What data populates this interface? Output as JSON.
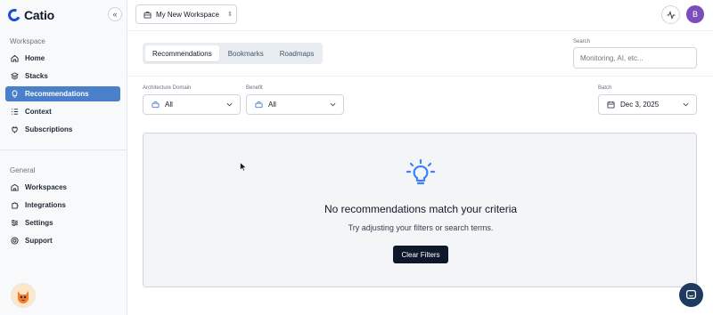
{
  "app": {
    "name": "Catio"
  },
  "sidebar": {
    "collapse_icon": "«",
    "workspace_section": "Workspace",
    "workspace_items": [
      {
        "label": "Home",
        "icon": "home-icon"
      },
      {
        "label": "Stacks",
        "icon": "layers-icon"
      },
      {
        "label": "Recommendations",
        "icon": "lightbulb-icon",
        "active": true
      },
      {
        "label": "Context",
        "icon": "list-icon"
      },
      {
        "label": "Subscriptions",
        "icon": "plug-icon"
      }
    ],
    "general_section": "General",
    "general_items": [
      {
        "label": "Workspaces",
        "icon": "building-icon"
      },
      {
        "label": "Integrations",
        "icon": "puzzle-icon"
      },
      {
        "label": "Settings",
        "icon": "sliders-icon"
      },
      {
        "label": "Support",
        "icon": "lifebuoy-icon"
      }
    ]
  },
  "topbar": {
    "workspace": "My New Workspace",
    "avatar_initial": "B"
  },
  "tabs": [
    {
      "label": "Recommendations",
      "active": true
    },
    {
      "label": "Bookmarks"
    },
    {
      "label": "Roadmaps"
    }
  ],
  "search": {
    "label": "Search",
    "placeholder": "Monitoring, AI, etc..."
  },
  "filters": {
    "domain": {
      "label": "Architecture Domain",
      "value": "All"
    },
    "benefit": {
      "label": "Benefit",
      "value": "All"
    },
    "batch": {
      "label": "Batch",
      "value": "Dec 3, 2025"
    }
  },
  "empty_state": {
    "title": "No recommendations match your criteria",
    "subtitle": "Try adjusting your filters or search terms.",
    "button": "Clear Filters"
  },
  "colors": {
    "accent": "#4a7fc9",
    "brand": "#1d4ed8",
    "dark_button": "#0f172a",
    "avatar": "#7c4dbd"
  }
}
